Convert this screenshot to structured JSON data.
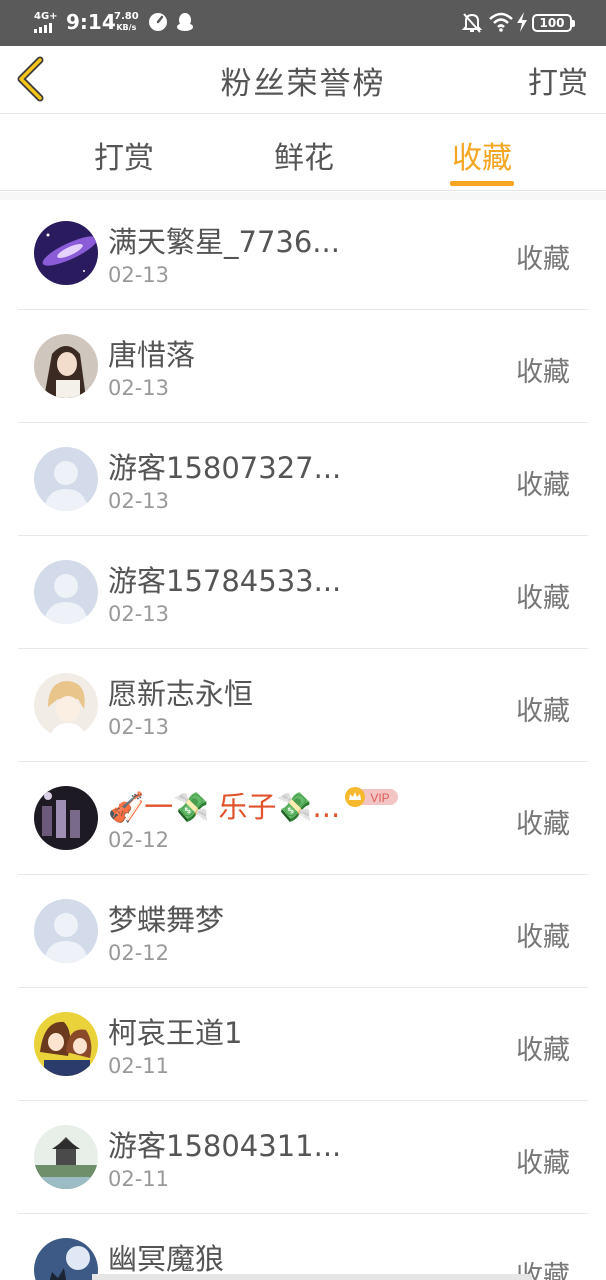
{
  "status_bar": {
    "network": "4G+",
    "time": "9:14",
    "speed_value": "7.80",
    "speed_unit": "KB/s",
    "battery": "100",
    "icons": [
      "signal-icon",
      "speedometer-icon",
      "qq-icon",
      "mute-icon",
      "wifi-icon",
      "charging-icon"
    ]
  },
  "header": {
    "title": "粉丝荣誉榜",
    "action": "打赏"
  },
  "tabs": [
    {
      "label": "打赏",
      "active": false
    },
    {
      "label": "鲜花",
      "active": false
    },
    {
      "label": "收藏",
      "active": true
    }
  ],
  "colors": {
    "accent": "#f5a623",
    "vip_name": "#e0532d"
  },
  "list": [
    {
      "name": "满天繁星_7736...",
      "date": "02-13",
      "action": "收藏",
      "avatar": "galaxy"
    },
    {
      "name": "唐惜落",
      "date": "02-13",
      "action": "收藏",
      "avatar": "girl-photo"
    },
    {
      "name": "游客15807327...",
      "date": "02-13",
      "action": "收藏",
      "avatar": "default-user"
    },
    {
      "name": "游客15784533...",
      "date": "02-13",
      "action": "收藏",
      "avatar": "default-user"
    },
    {
      "name": "愿新志永恒",
      "date": "02-13",
      "action": "收藏",
      "avatar": "anime-boy"
    },
    {
      "name": "🎻一💸 乐子💸...",
      "date": "02-12",
      "action": "收藏",
      "avatar": "concert",
      "vip": "VIP"
    },
    {
      "name": "梦蝶舞梦",
      "date": "02-12",
      "action": "收藏",
      "avatar": "default-user"
    },
    {
      "name": "柯哀王道1",
      "date": "02-11",
      "action": "收藏",
      "avatar": "anime-girls"
    },
    {
      "name": "游客15804311...",
      "date": "02-11",
      "action": "收藏",
      "avatar": "pagoda-landscape"
    },
    {
      "name": "幽冥魔狼",
      "date": "",
      "action": "收藏",
      "avatar": "wolf-moon"
    }
  ]
}
